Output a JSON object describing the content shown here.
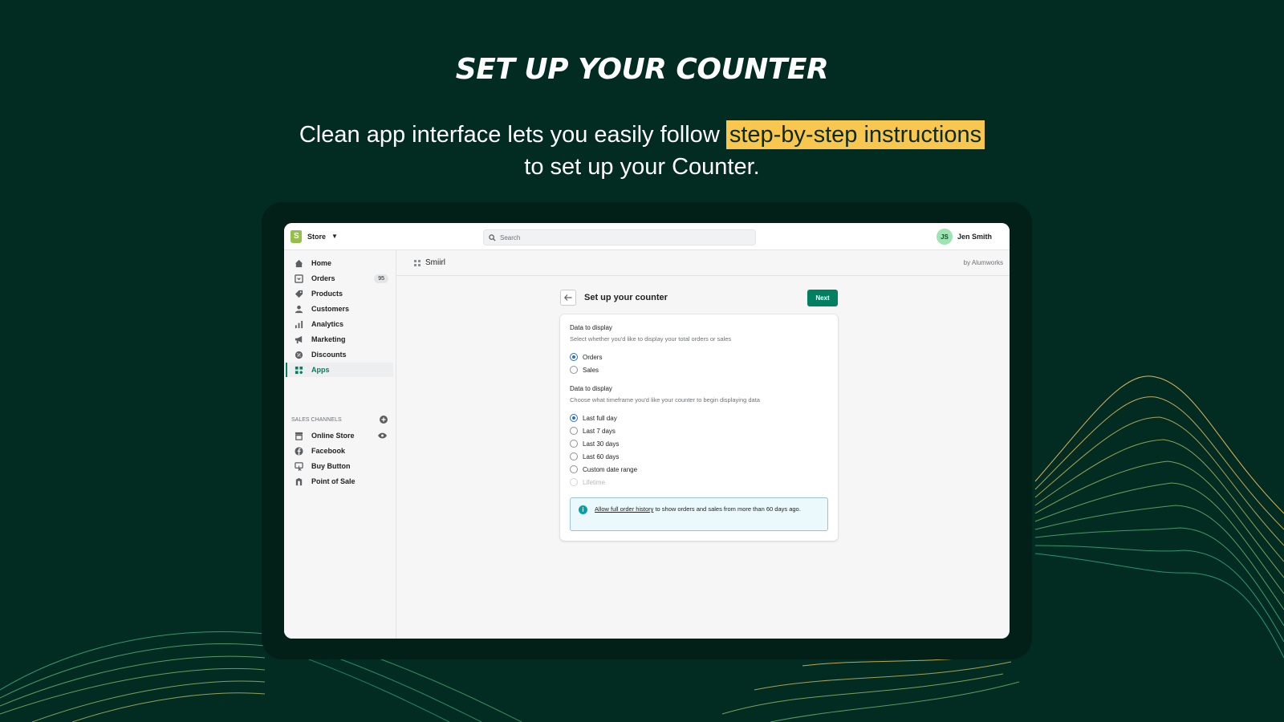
{
  "hero": {
    "title": "SET UP YOUR COUNTER",
    "subtitle_pre": "Clean app interface lets you easily follow ",
    "subtitle_highlight": "step-by-step instructions",
    "subtitle_post": "to set up your Counter."
  },
  "colors": {
    "background": "#022b22",
    "highlight": "#f9c74f",
    "accent": "#008060",
    "radio_selected": "#2c6ecb"
  },
  "topbar": {
    "store_label": "Store",
    "search_placeholder": "Search",
    "user_initials": "JS",
    "user_name": "Jen Smith"
  },
  "sidebar": {
    "items": [
      {
        "label": "Home",
        "icon": "home-icon"
      },
      {
        "label": "Orders",
        "icon": "orders-icon",
        "badge": "95"
      },
      {
        "label": "Products",
        "icon": "tag-icon"
      },
      {
        "label": "Customers",
        "icon": "person-icon"
      },
      {
        "label": "Analytics",
        "icon": "bar-chart-icon"
      },
      {
        "label": "Marketing",
        "icon": "megaphone-icon"
      },
      {
        "label": "Discounts",
        "icon": "discount-icon"
      },
      {
        "label": "Apps",
        "icon": "apps-icon",
        "active": true
      }
    ],
    "channels_heading": "SALES CHANNELS",
    "channels": [
      {
        "label": "Online Store",
        "icon": "store-icon"
      },
      {
        "label": "Facebook",
        "icon": "facebook-icon"
      },
      {
        "label": "Buy Button",
        "icon": "buy-button-icon"
      },
      {
        "label": "Point of Sale",
        "icon": "pos-icon"
      }
    ]
  },
  "appbar": {
    "app_name": "Smiirl",
    "by": "by Alumworks"
  },
  "page": {
    "title": "Set up your counter",
    "next_label": "Next"
  },
  "form": {
    "section1": {
      "title": "Data to display",
      "help": "Select whether you'd like to display your total orders or sales",
      "options": [
        "Orders",
        "Sales"
      ],
      "selected": "Orders"
    },
    "section2": {
      "title": "Data to display",
      "help": "Choose what timeframe you'd like your counter to begin displaying data",
      "options": [
        "Last full day",
        "Last 7 days",
        "Last 30 days",
        "Last 60 days",
        "Custom date range",
        "Lifetime"
      ],
      "selected": "Last full day",
      "disabled": "Lifetime"
    },
    "banner": {
      "link": "Allow full order history",
      "text": " to show orders and sales from more than 60 days ago."
    }
  }
}
